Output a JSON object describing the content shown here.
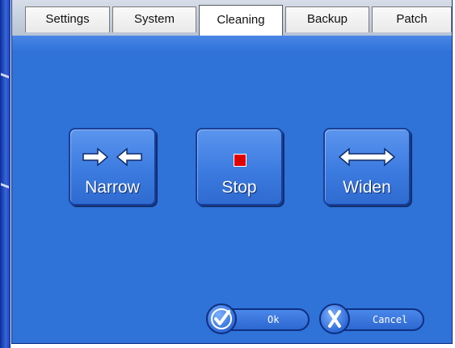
{
  "tabs": [
    {
      "label": "Settings",
      "active": false
    },
    {
      "label": "System",
      "active": false
    },
    {
      "label": "Cleaning",
      "active": true
    },
    {
      "label": "Backup",
      "active": false
    },
    {
      "label": "Patch",
      "active": false
    }
  ],
  "controls": {
    "narrow": {
      "label": "Narrow",
      "icon": "arrows-converge-icon"
    },
    "stop": {
      "label": "Stop",
      "icon": "stop-square-icon",
      "icon_color": "#e00000"
    },
    "widen": {
      "label": "Widen",
      "icon": "arrows-diverge-icon"
    }
  },
  "footer": {
    "ok_label": "Ok",
    "ok_icon": "checkmark-icon",
    "cancel_label": "Cancel",
    "cancel_icon": "x-icon"
  },
  "colors": {
    "panel": "#2f72d8",
    "button": "#3c7be0",
    "accent_dark": "#0f2f80"
  }
}
